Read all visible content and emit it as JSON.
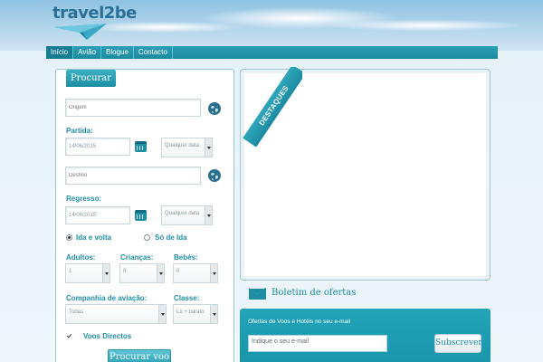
{
  "brand": {
    "name": "travel2be"
  },
  "nav": {
    "items": [
      {
        "label": "Início"
      },
      {
        "label": "Avião"
      },
      {
        "label": "Blogue"
      },
      {
        "label": "Contacto"
      }
    ],
    "active_index": 0
  },
  "search": {
    "tab_label": "Procurar",
    "origin_placeholder": "Origem",
    "departure_label": "Partida:",
    "departure_date": "14/06/2015",
    "departure_time": "Qualquer data",
    "destination_placeholder": "Destino",
    "return_label": "Regresso:",
    "return_date": "14/06/2015",
    "return_time": "Qualquer data",
    "trip_roundtrip": "Ida e volta",
    "trip_oneway": "Só de Ida",
    "trip_selected": "roundtrip",
    "adults_label": "Adultos:",
    "adults_value": "1",
    "children_label": "Crianças:",
    "children_value": "0",
    "infants_label": "Bebés:",
    "infants_value": "0",
    "airline_label": "Companhia de aviação:",
    "airline_value": "Todas",
    "class_label": "Classe:",
    "class_value": "Lo + barato",
    "direct_label": "Voos Directos",
    "submit_label": "Procurar voo"
  },
  "highlights": {
    "ribbon_label": "DESTAQUES"
  },
  "newsletter": {
    "title": "Boletim de ofertas",
    "description": "Ofertas de Voos e Hotéis no seu e-mail",
    "email_placeholder": "Indique o seu e-mail",
    "subscribe_label": "Subscrever"
  },
  "colors": {
    "accent": "#1f8ea3",
    "nav": "#1d8aa0",
    "panel_border": "#9dc7d4"
  },
  "icons": [
    "globe-icon",
    "calendar-icon",
    "envelope-icon",
    "paper-plane-logo"
  ]
}
